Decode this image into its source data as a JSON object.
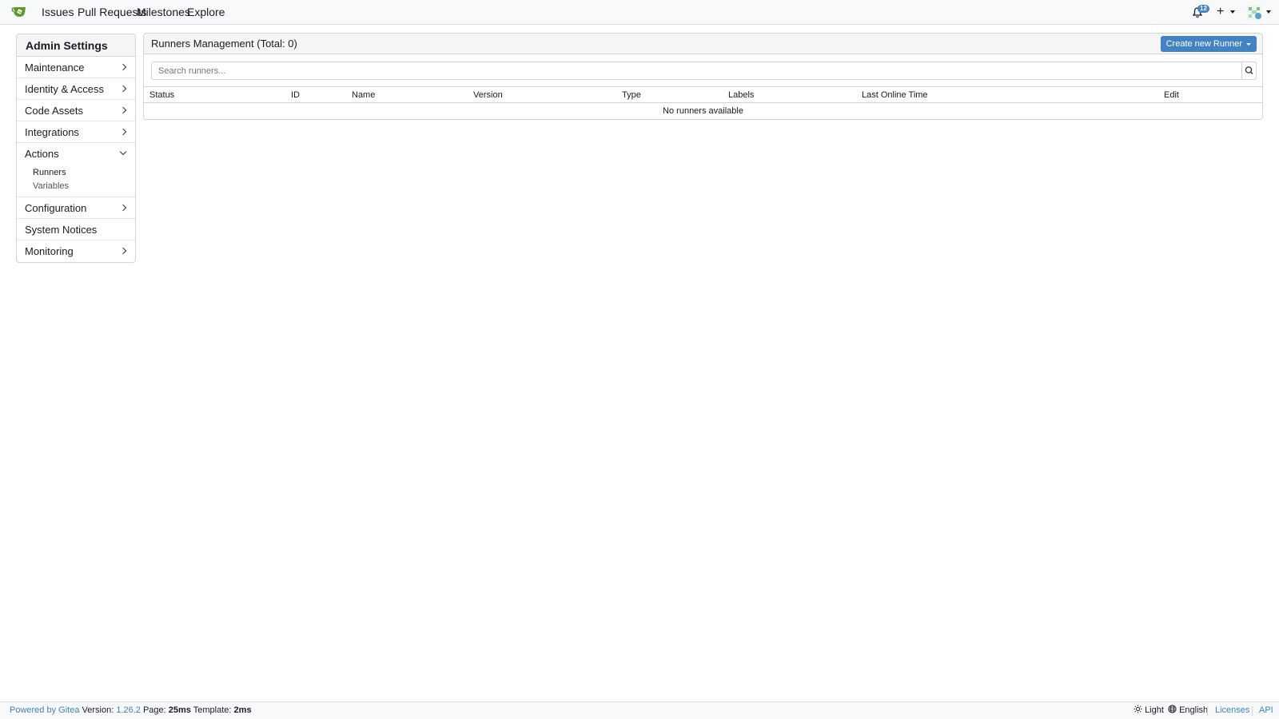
{
  "navbar": {
    "logo": "gitea-logo",
    "links": [
      "Issues",
      "Pull Requests",
      "Milestones",
      "Explore"
    ],
    "notification_count": "12",
    "create_icon": "+"
  },
  "sidebar": {
    "title": "Admin Settings",
    "items": {
      "maintenance": "Maintenance",
      "identity": "Identity & Access",
      "code_assets": "Code Assets",
      "integrations": "Integrations",
      "actions": "Actions",
      "configuration": "Configuration",
      "system_notices": "System Notices",
      "monitoring": "Monitoring"
    },
    "actions_sub": {
      "runners": "Runners",
      "variables": "Variables"
    }
  },
  "main": {
    "title": "Runners Management (Total: 0)",
    "create_button": "Create new Runner",
    "search_placeholder": "Search runners...",
    "columns": [
      "Status",
      "ID",
      "Name",
      "Version",
      "Type",
      "Labels",
      "Last Online Time",
      "Edit"
    ],
    "empty_message": "No runners available"
  },
  "footer": {
    "powered_by": "Powered by Gitea",
    "version_label": "Version:",
    "version": "1.26.2",
    "page_label": "Page:",
    "page_time": "25ms",
    "template_label": "Template:",
    "template_time": "2ms",
    "theme": "Light",
    "language": "English",
    "licenses": "Licenses",
    "api": "API"
  },
  "colors": {
    "accent": "#4183c4",
    "logo_green": "#609926"
  }
}
